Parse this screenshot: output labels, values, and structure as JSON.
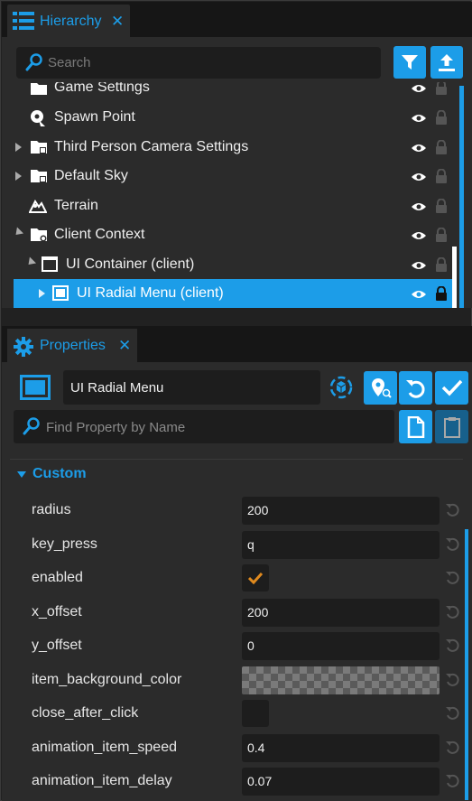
{
  "hierarchy": {
    "tab_title": "Hierarchy",
    "close_glyph": "✕",
    "search_placeholder": "Search",
    "filter_icon": "filter-icon",
    "upload_icon": "upload-icon",
    "items": [
      {
        "label": "Game Settings",
        "icon": "gear-folder-icon",
        "expander": "none"
      },
      {
        "label": "Spawn Point",
        "icon": "spawn-point-icon",
        "expander": "none"
      },
      {
        "label": "Third Person Camera Settings",
        "icon": "folder-icon",
        "expander": "collapsed"
      },
      {
        "label": "Default Sky",
        "icon": "folder-icon",
        "expander": "collapsed"
      },
      {
        "label": "Terrain",
        "icon": "terrain-icon",
        "expander": "none"
      },
      {
        "label": "Client Context",
        "icon": "context-folder-icon",
        "expander": "expanded"
      },
      {
        "label": "UI Container (client)",
        "icon": "ui-container-icon",
        "expander": "expanded"
      },
      {
        "label": "UI Radial Menu (client)",
        "icon": "ui-panel-icon",
        "expander": "collapsed",
        "selected": true
      }
    ]
  },
  "properties": {
    "tab_title": "Properties",
    "close_glyph": "✕",
    "object_name": "UI Radial Menu",
    "find_placeholder": "Find Property by Name",
    "section_title": "Custom",
    "fields": [
      {
        "name": "radius",
        "type": "text",
        "value": "200"
      },
      {
        "name": "key_press",
        "type": "text",
        "value": "q"
      },
      {
        "name": "enabled",
        "type": "checkbox",
        "checked": true
      },
      {
        "name": "x_offset",
        "type": "text",
        "value": "200"
      },
      {
        "name": "y_offset",
        "type": "text",
        "value": "0"
      },
      {
        "name": "item_background_color",
        "type": "color",
        "value": "transparent"
      },
      {
        "name": "close_after_click",
        "type": "checkbox",
        "checked": false
      },
      {
        "name": "animation_item_speed",
        "type": "text",
        "value": "0.4"
      },
      {
        "name": "animation_item_delay",
        "type": "text",
        "value": "0.07"
      }
    ]
  },
  "colors": {
    "accent": "#1c9de8",
    "panel": "#2b2b2b",
    "field": "#1d1d1d",
    "check": "#e08a1e"
  }
}
